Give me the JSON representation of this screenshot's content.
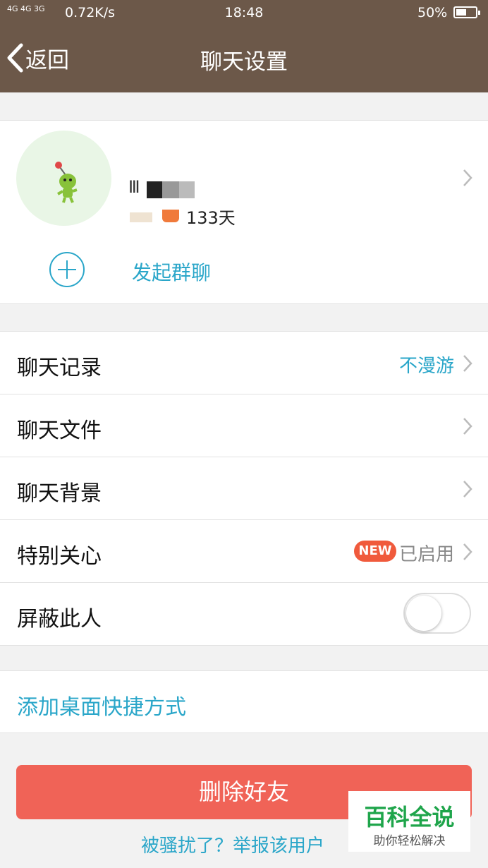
{
  "status_bar": {
    "signal": "4G 4G 3G",
    "speed": "0.72K/s",
    "time": "18:48",
    "battery": "50%",
    "battery_level": 0.5
  },
  "nav": {
    "back_label": "返回",
    "title": "聊天设置"
  },
  "profile": {
    "name_partial": "Ⅲ",
    "days_label": "133天"
  },
  "group_chat": {
    "label": "发起群聊"
  },
  "settings": [
    {
      "label": "聊天记录",
      "value": "不漫游"
    },
    {
      "label": "聊天文件",
      "value": ""
    },
    {
      "label": "聊天背景",
      "value": ""
    },
    {
      "label": "特别关心",
      "badge": "NEW",
      "value": "已启用"
    },
    {
      "label": "屏蔽此人",
      "toggle": false
    }
  ],
  "shortcut": {
    "label": "添加桌面快捷方式"
  },
  "delete_button": {
    "label": "删除好友"
  },
  "report_link": {
    "label": "被骚扰了？举报该用户"
  },
  "watermark": {
    "title": "百科全说",
    "subtitle": "助你轻松解决"
  },
  "colors": {
    "topbar": "#6c5849",
    "accent": "#2aa6c9",
    "delete": "#f06357",
    "badge": "#f05a3c"
  }
}
